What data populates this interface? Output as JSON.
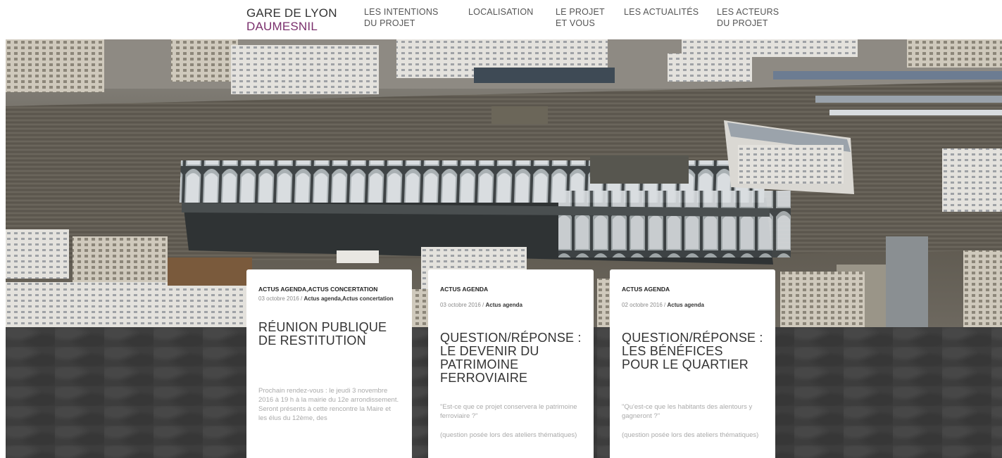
{
  "site": {
    "logo_line1": "GARE DE LYON",
    "logo_line2": "DAUMESNIL",
    "accent_color": "#7a2f6c"
  },
  "nav": {
    "items": [
      {
        "line1": "LES INTENTIONS",
        "line2": "DU PROJET"
      },
      {
        "line1": "LOCALISATION",
        "line2": ""
      },
      {
        "line1": "LE PROJET",
        "line2": "ET VOUS"
      },
      {
        "line1": "LES ACTUALITÉS",
        "line2": ""
      },
      {
        "line1": "LES ACTEURS",
        "line2": "DU PROJET"
      }
    ]
  },
  "hero": {
    "image": "aerial-photo-gare-de-lyon-railway-yard"
  },
  "cards": [
    {
      "category": "ACTUS AGENDA,ACTUS CONCERTATION",
      "date": "03 octobre 2016",
      "sep": " / ",
      "tags": "Actus agenda,Actus concertation",
      "title": "RÉUNION PUBLIQUE DE RESTITUTION",
      "p1": "Prochain rendez-vous : le jeudi 3 novembre 2016 à 19 h à la mairie du 12e arrondissement. Seront présents à cette rencontre la Maire et les élus du 12ème, des",
      "p2": ""
    },
    {
      "category": "ACTUS AGENDA",
      "date": "03 octobre 2016",
      "sep": " / ",
      "tags": "Actus agenda",
      "title": "QUESTION/RÉPONSE : LE DEVENIR DU PATRIMOINE FERROVIAIRE",
      "p1": "\"Est-ce que ce projet conservera le patrimoine ferroviaire ?\"",
      "p2": "(question posée lors des ateliers thématiques)"
    },
    {
      "category": "ACTUS AGENDA",
      "date": "02 octobre 2016",
      "sep": " / ",
      "tags": "Actus agenda",
      "title": "QUESTION/RÉPONSE : LES BÉNÉFICES POUR LE QUARTIER",
      "p1": "\"Qu'est-ce que les habitants des alentours y gagneront ?\"",
      "p2": "(question posée lors des ateliers thématiques)"
    }
  ]
}
